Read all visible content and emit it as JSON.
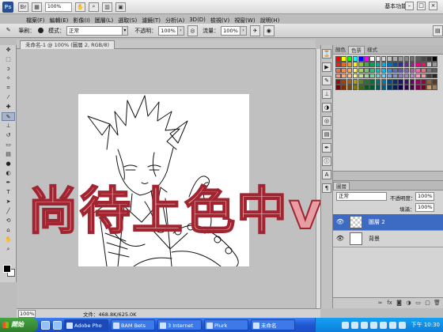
{
  "app": {
    "logo_text": "Ps",
    "workspace_label": "基本功能 ▾"
  },
  "menubar": {
    "zoom_value": "100%",
    "items": [
      {
        "label": "檔案(F)"
      },
      {
        "label": "編輯(E)"
      },
      {
        "label": "影像(I)"
      },
      {
        "label": "圖層(L)"
      },
      {
        "label": "選取(S)"
      },
      {
        "label": "濾鏡(T)"
      },
      {
        "label": "分析(A)"
      },
      {
        "label": "3D(D)"
      },
      {
        "label": "檢視(V)"
      },
      {
        "label": "視窗(W)"
      },
      {
        "label": "說明(H)"
      }
    ]
  },
  "options": {
    "brush_label": "筆刷：",
    "mode_label": "模式：",
    "mode_value": "正常",
    "opacity_label": "不透明：",
    "opacity_value": "100%",
    "flow_label": "流量：",
    "flow_value": "100%"
  },
  "document": {
    "tab_title": "未命名-1 @ 100% (圖層 2, RGB/8)",
    "status_zoom": "100%",
    "status_doc": "文件：468.8K/625.0K"
  },
  "overlay": {
    "text": "尚待上色中v"
  },
  "swatches": {
    "tabs": [
      {
        "label": "顏色"
      },
      {
        "label": "色票"
      },
      {
        "label": "樣式"
      }
    ],
    "colors": [
      "#ff0000",
      "#ffff00",
      "#00ff00",
      "#00ffff",
      "#0000ff",
      "#ff00ff",
      "#ffffff",
      "#ebebeb",
      "#d6d6d6",
      "#c2c2c2",
      "#adadad",
      "#999999",
      "#858585",
      "#707070",
      "#5c5c5c",
      "#474747",
      "#333333",
      "#000000",
      "#ee1d24",
      "#f16522",
      "#f7941d",
      "#fff100",
      "#8fc63d",
      "#37b34a",
      "#00a650",
      "#00a99e",
      "#00aeef",
      "#0072bc",
      "#0054a5",
      "#2e3192",
      "#652d90",
      "#92278f",
      "#ec008c",
      "#ed145b",
      "#c2c2c2",
      "#999999",
      "#f26c4f",
      "#f68e55",
      "#fbaf5c",
      "#fff467",
      "#acd372",
      "#7dc473",
      "#39b778",
      "#16bcb4",
      "#00bff3",
      "#438ccb",
      "#5573b7",
      "#5e5ca7",
      "#855fa8",
      "#a763a9",
      "#ef6ea8",
      "#f16d7e",
      "#7a7a7a",
      "#5c5c5c",
      "#f69679",
      "#f9ad81",
      "#fdc68c",
      "#fff799",
      "#c6df9c",
      "#a4d49d",
      "#81ca9d",
      "#7bcdc9",
      "#6ccff7",
      "#7ca6d8",
      "#8293ca",
      "#8881be",
      "#a286bd",
      "#bc8cbf",
      "#f49bc1",
      "#f5989d",
      "#3d3d3d",
      "#262626",
      "#9e0b0f",
      "#a0410d",
      "#a3620a",
      "#aba000",
      "#598527",
      "#1a7b30",
      "#007236",
      "#00736a",
      "#0076a4",
      "#004a80",
      "#003471",
      "#1b1464",
      "#440e62",
      "#630460",
      "#9e005d",
      "#9e0039",
      "#8c6239",
      "#603813",
      "#790000",
      "#7b2e00",
      "#7d4900",
      "#827b00",
      "#406618",
      "#005e20",
      "#005826",
      "#005952",
      "#005b7f",
      "#003663",
      "#002157",
      "#0d004c",
      "#32004b",
      "#4b0049",
      "#7b0046",
      "#7a0026",
      "#c69c6d",
      "#a67c52"
    ]
  },
  "layers": {
    "tab_label": "圖層",
    "blend_mode": "正常",
    "opacity_label": "不透明度：",
    "opacity_value": "100%",
    "fill_label": "填滿：",
    "fill_value": "100%",
    "items": [
      {
        "name": "圖層 2",
        "selected": true
      },
      {
        "name": "背景",
        "selected": false
      }
    ]
  },
  "taskbar": {
    "start_label": "開始",
    "buttons": [
      {
        "label": "Adobe Pho"
      },
      {
        "label": "BAM Bets"
      },
      {
        "label": "3 Internet"
      },
      {
        "label": "Plurk"
      },
      {
        "label": "未命名"
      }
    ],
    "clock": "下午 10:30"
  }
}
